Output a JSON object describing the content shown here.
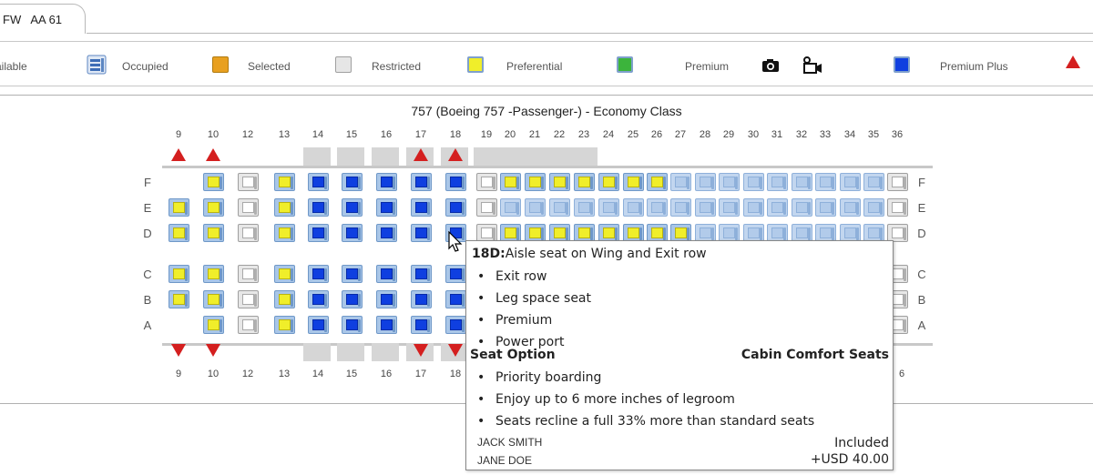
{
  "tab": {
    "label": "FW   AA 61"
  },
  "legend": {
    "items": [
      {
        "label": "Available",
        "visible_label": "vailable",
        "style": "none"
      },
      {
        "label": "Occupied",
        "style": "occupied",
        "icon": "occupied-seat-icon"
      },
      {
        "label": "Selected",
        "style": "selected",
        "color": "#e8a020"
      },
      {
        "label": "Restricted",
        "style": "restricted",
        "color": "#e6e6e6"
      },
      {
        "label": "Preferential",
        "style": "preferential",
        "color": "#f0ee2a"
      },
      {
        "label": "Premium",
        "style": "premium",
        "color": "#3cb43c"
      },
      {
        "label": "Premium Plus",
        "style": "premium-plus",
        "color": "#0f3fe0"
      }
    ],
    "extra_icons": [
      "camera-icon",
      "video-camera-icon",
      "exit-arrow-icon"
    ]
  },
  "seatmap": {
    "title": "757 (Boeing 757 -Passenger-) - Economy Class",
    "columns": [
      "9",
      "10",
      "12",
      "13",
      "14",
      "15",
      "16",
      "17",
      "18",
      "19",
      "20",
      "21",
      "22",
      "23",
      "24",
      "25",
      "26",
      "27",
      "28",
      "29",
      "30",
      "31",
      "32",
      "33",
      "34",
      "35",
      "36"
    ],
    "bottom_columns_visible": [
      "9",
      "10",
      "12",
      "13",
      "14",
      "15",
      "16",
      "17",
      "18"
    ],
    "bottom_last_visible": "6",
    "rows_left": [
      "F",
      "E",
      "D",
      "C",
      "B",
      "A"
    ],
    "rows_right": [
      "F",
      "E",
      "D",
      "C",
      "B",
      "A"
    ],
    "exit_rows": [
      "9",
      "10",
      "17",
      "18"
    ],
    "colors": {
      "premium_plus": "#0f3fe0",
      "preferential": "#f0ee2a",
      "restricted": "#e6e6e6",
      "available_light": "#b2cbea",
      "exit": "#d41f1f"
    }
  },
  "tooltip": {
    "seat": "18D:",
    "description": "Aisle seat on Wing and Exit row",
    "features": [
      "Exit row",
      "Leg space seat",
      "Premium",
      "Power port"
    ],
    "option_label": "Seat Option",
    "option_value": "Cabin Comfort Seats",
    "benefits": [
      "Priority boarding",
      "Enjoy up to 6 more inches of legroom",
      "Seats recline a full 33% more than standard seats"
    ],
    "passengers": [
      {
        "name": "JACK SMITH",
        "price": "Included"
      },
      {
        "name": "JANE DOE",
        "price": "+USD 40.00"
      }
    ]
  }
}
